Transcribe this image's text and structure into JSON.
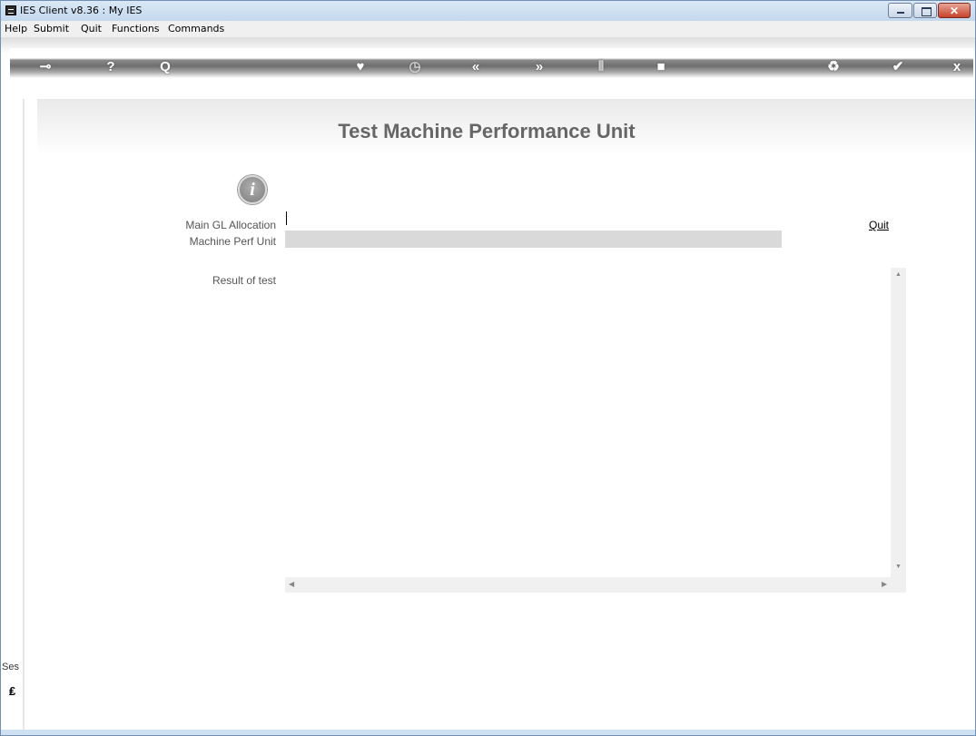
{
  "window": {
    "title": "IES Client v8.36 : My IES",
    "close_glyph": "✕"
  },
  "menu": [
    "Help",
    "Submit",
    "Quit",
    "Functions",
    "Commands"
  ],
  "toolbar": {
    "icons": [
      "key-icon",
      "help-icon",
      "search-icon",
      "heart-icon",
      "clock-icon",
      "rewind-icon",
      "fast-forward-icon",
      "tools-icon",
      "stop-icon",
      "recycle-icon",
      "check-icon",
      "close-icon"
    ]
  },
  "sidebar": {
    "label": "Ses"
  },
  "page": {
    "title": "Test Machine Performance Unit",
    "info_glyph": "i"
  },
  "form": {
    "main_gl_label": "Main GL Allocation",
    "main_gl_value": "",
    "machine_perf_label": "Machine Perf Unit",
    "machine_perf_value": "",
    "result_label": "Result of test",
    "result_value": "",
    "quit_label": "Quit"
  }
}
